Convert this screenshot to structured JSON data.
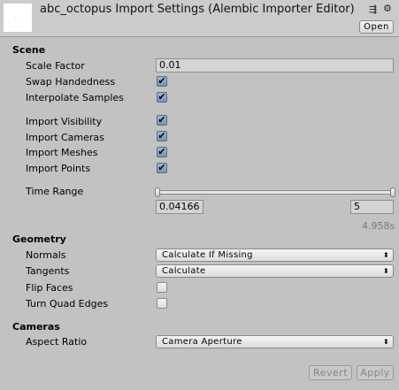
{
  "header": {
    "title": "abc_octopus Import Settings (Alembic Importer Editor)",
    "open_label": "Open",
    "icons": [
      "preset-icon",
      "gear-icon"
    ]
  },
  "scene": {
    "title": "Scene",
    "scale_factor": {
      "label": "Scale Factor",
      "value": "0.01"
    },
    "swap_handedness": {
      "label": "Swap Handedness",
      "checked": true
    },
    "interpolate_samples": {
      "label": "Interpolate Samples",
      "checked": true
    },
    "import_visibility": {
      "label": "Import Visibility",
      "checked": true
    },
    "import_cameras": {
      "label": "Import Cameras",
      "checked": true
    },
    "import_meshes": {
      "label": "Import Meshes",
      "checked": true
    },
    "import_points": {
      "label": "Import Points",
      "checked": true
    },
    "time_range": {
      "label": "Time Range",
      "start": "0.04166",
      "end": "5",
      "duration": "4.958s"
    }
  },
  "geometry": {
    "title": "Geometry",
    "normals": {
      "label": "Normals",
      "value": "Calculate If Missing"
    },
    "tangents": {
      "label": "Tangents",
      "value": "Calculate"
    },
    "flip_faces": {
      "label": "Flip Faces",
      "checked": false
    },
    "turn_quad_edges": {
      "label": "Turn Quad Edges",
      "checked": false
    }
  },
  "cameras": {
    "title": "Cameras",
    "aspect_ratio": {
      "label": "Aspect Ratio",
      "value": "Camera Aperture"
    }
  },
  "footer": {
    "revert_label": "Revert",
    "apply_label": "Apply"
  },
  "check_glyph": "✔",
  "dropdown_glyph": "⬍"
}
